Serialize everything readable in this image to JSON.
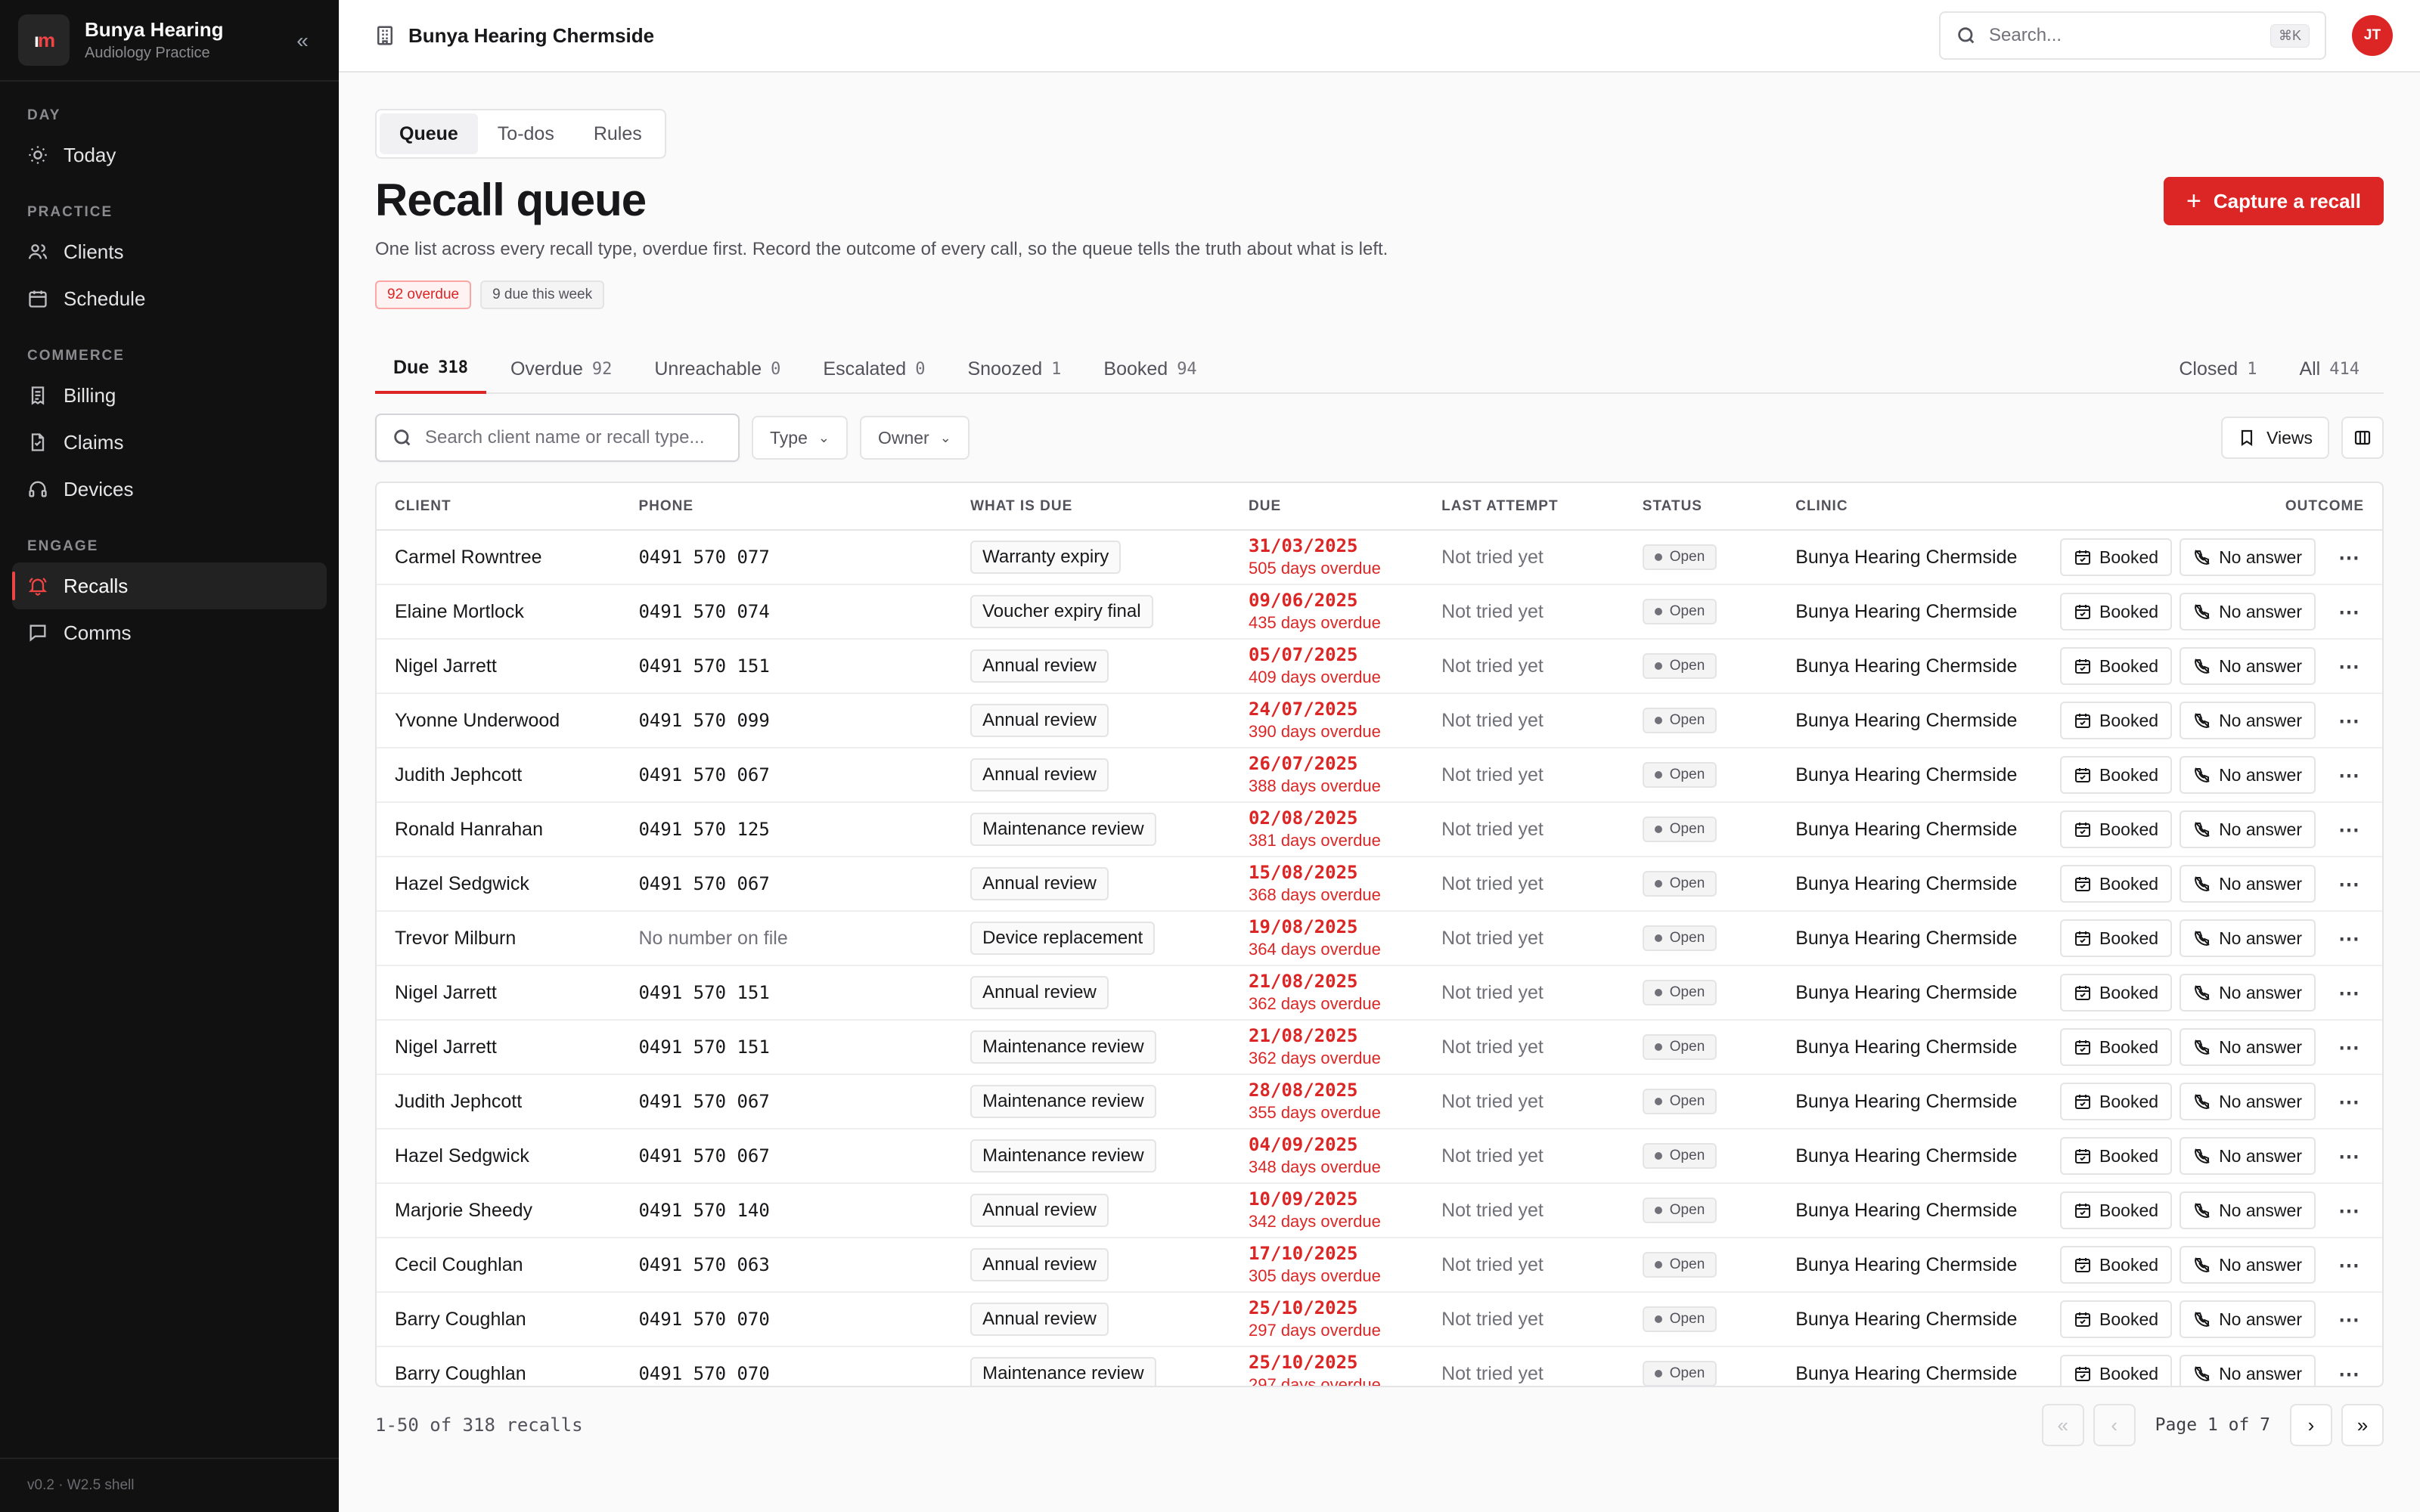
{
  "brand": {
    "name": "Bunya Hearing",
    "subtitle": "Audiology Practice",
    "logo_a": "ı",
    "logo_b": "m"
  },
  "sidebar": {
    "sections": [
      {
        "title": "DAY",
        "items": [
          {
            "label": "Today",
            "icon": "sun-icon"
          }
        ]
      },
      {
        "title": "PRACTICE",
        "items": [
          {
            "label": "Clients",
            "icon": "users-icon"
          },
          {
            "label": "Schedule",
            "icon": "calendar-icon"
          }
        ]
      },
      {
        "title": "COMMERCE",
        "items": [
          {
            "label": "Billing",
            "icon": "receipt-icon"
          },
          {
            "label": "Claims",
            "icon": "file-icon"
          },
          {
            "label": "Devices",
            "icon": "headphones-icon"
          }
        ]
      },
      {
        "title": "ENGAGE",
        "items": [
          {
            "label": "Recalls",
            "icon": "bell-icon",
            "active": true
          },
          {
            "label": "Comms",
            "icon": "message-icon"
          }
        ]
      }
    ],
    "footer": "v0.2 · W2.5 shell"
  },
  "topbar": {
    "clinic": "Bunya Hearing Chermside",
    "search_placeholder": "Search...",
    "shortcut": "⌘K",
    "avatar": "JT"
  },
  "page": {
    "segments": [
      "Queue",
      "To-dos",
      "Rules"
    ],
    "active_segment": 0,
    "title": "Recall queue",
    "description": "One list across every recall type, overdue first. Record the outcome of every call, so the queue tells the truth about what is left.",
    "pill_overdue": "92 overdue",
    "pill_week": "9 due this week",
    "capture_label": "Capture a recall"
  },
  "tabs": [
    {
      "label": "Due",
      "count": "318",
      "active": true
    },
    {
      "label": "Overdue",
      "count": "92"
    },
    {
      "label": "Unreachable",
      "count": "0"
    },
    {
      "label": "Escalated",
      "count": "0"
    },
    {
      "label": "Snoozed",
      "count": "1"
    },
    {
      "label": "Booked",
      "count": "94"
    }
  ],
  "tabs_right": [
    {
      "label": "Closed",
      "count": "1"
    },
    {
      "label": "All",
      "count": "414"
    }
  ],
  "filters": {
    "search_placeholder": "Search client name or recall type...",
    "type_label": "Type",
    "owner_label": "Owner",
    "views_label": "Views"
  },
  "table": {
    "headers": [
      "CLIENT",
      "PHONE",
      "WHAT IS DUE",
      "DUE",
      "LAST ATTEMPT",
      "STATUS",
      "CLINIC",
      "OUTCOME"
    ],
    "booked_label": "Booked",
    "noanswer_label": "No answer",
    "rows": [
      {
        "client": "Carmel Rowntree",
        "phone": "0491 570 077",
        "due_what": "Warranty expiry",
        "due_date": "31/03/2025",
        "overdue": "505 days overdue",
        "last": "Not tried yet",
        "status": "Open",
        "clinic": "Bunya Hearing Chermside"
      },
      {
        "client": "Elaine Mortlock",
        "phone": "0491 570 074",
        "due_what": "Voucher expiry final",
        "due_date": "09/06/2025",
        "overdue": "435 days overdue",
        "last": "Not tried yet",
        "status": "Open",
        "clinic": "Bunya Hearing Chermside"
      },
      {
        "client": "Nigel Jarrett",
        "phone": "0491 570 151",
        "due_what": "Annual review",
        "due_date": "05/07/2025",
        "overdue": "409 days overdue",
        "last": "Not tried yet",
        "status": "Open",
        "clinic": "Bunya Hearing Chermside"
      },
      {
        "client": "Yvonne Underwood",
        "phone": "0491 570 099",
        "due_what": "Annual review",
        "due_date": "24/07/2025",
        "overdue": "390 days overdue",
        "last": "Not tried yet",
        "status": "Open",
        "clinic": "Bunya Hearing Chermside"
      },
      {
        "client": "Judith Jephcott",
        "phone": "0491 570 067",
        "due_what": "Annual review",
        "due_date": "26/07/2025",
        "overdue": "388 days overdue",
        "last": "Not tried yet",
        "status": "Open",
        "clinic": "Bunya Hearing Chermside"
      },
      {
        "client": "Ronald Hanrahan",
        "phone": "0491 570 125",
        "due_what": "Maintenance review",
        "due_date": "02/08/2025",
        "overdue": "381 days overdue",
        "last": "Not tried yet",
        "status": "Open",
        "clinic": "Bunya Hearing Chermside"
      },
      {
        "client": "Hazel Sedgwick",
        "phone": "0491 570 067",
        "due_what": "Annual review",
        "due_date": "15/08/2025",
        "overdue": "368 days overdue",
        "last": "Not tried yet",
        "status": "Open",
        "clinic": "Bunya Hearing Chermside"
      },
      {
        "client": "Trevor Milburn",
        "phone": "No number on file",
        "phone_missing": true,
        "due_what": "Device replacement",
        "due_date": "19/08/2025",
        "overdue": "364 days overdue",
        "last": "Not tried yet",
        "status": "Open",
        "clinic": "Bunya Hearing Chermside"
      },
      {
        "client": "Nigel Jarrett",
        "phone": "0491 570 151",
        "due_what": "Annual review",
        "due_date": "21/08/2025",
        "overdue": "362 days overdue",
        "last": "Not tried yet",
        "status": "Open",
        "clinic": "Bunya Hearing Chermside"
      },
      {
        "client": "Nigel Jarrett",
        "phone": "0491 570 151",
        "due_what": "Maintenance review",
        "due_date": "21/08/2025",
        "overdue": "362 days overdue",
        "last": "Not tried yet",
        "status": "Open",
        "clinic": "Bunya Hearing Chermside"
      },
      {
        "client": "Judith Jephcott",
        "phone": "0491 570 067",
        "due_what": "Maintenance review",
        "due_date": "28/08/2025",
        "overdue": "355 days overdue",
        "last": "Not tried yet",
        "status": "Open",
        "clinic": "Bunya Hearing Chermside"
      },
      {
        "client": "Hazel Sedgwick",
        "phone": "0491 570 067",
        "due_what": "Maintenance review",
        "due_date": "04/09/2025",
        "overdue": "348 days overdue",
        "last": "Not tried yet",
        "status": "Open",
        "clinic": "Bunya Hearing Chermside"
      },
      {
        "client": "Marjorie Sheedy",
        "phone": "0491 570 140",
        "due_what": "Annual review",
        "due_date": "10/09/2025",
        "overdue": "342 days overdue",
        "last": "Not tried yet",
        "status": "Open",
        "clinic": "Bunya Hearing Chermside"
      },
      {
        "client": "Cecil Coughlan",
        "phone": "0491 570 063",
        "due_what": "Annual review",
        "due_date": "17/10/2025",
        "overdue": "305 days overdue",
        "last": "Not tried yet",
        "status": "Open",
        "clinic": "Bunya Hearing Chermside"
      },
      {
        "client": "Barry Coughlan",
        "phone": "0491 570 070",
        "due_what": "Annual review",
        "due_date": "25/10/2025",
        "overdue": "297 days overdue",
        "last": "Not tried yet",
        "status": "Open",
        "clinic": "Bunya Hearing Chermside"
      },
      {
        "client": "Barry Coughlan",
        "phone": "0491 570 070",
        "due_what": "Maintenance review",
        "due_date": "25/10/2025",
        "overdue": "297 days overdue",
        "last": "Not tried yet",
        "status": "Open",
        "clinic": "Bunya Hearing Chermside"
      }
    ]
  },
  "footer": {
    "count": "1-50 of 318 recalls",
    "page_label": "Page 1 of 7"
  },
  "colors": {
    "accent": "#dc2626",
    "sidebar_bg": "#111111"
  }
}
